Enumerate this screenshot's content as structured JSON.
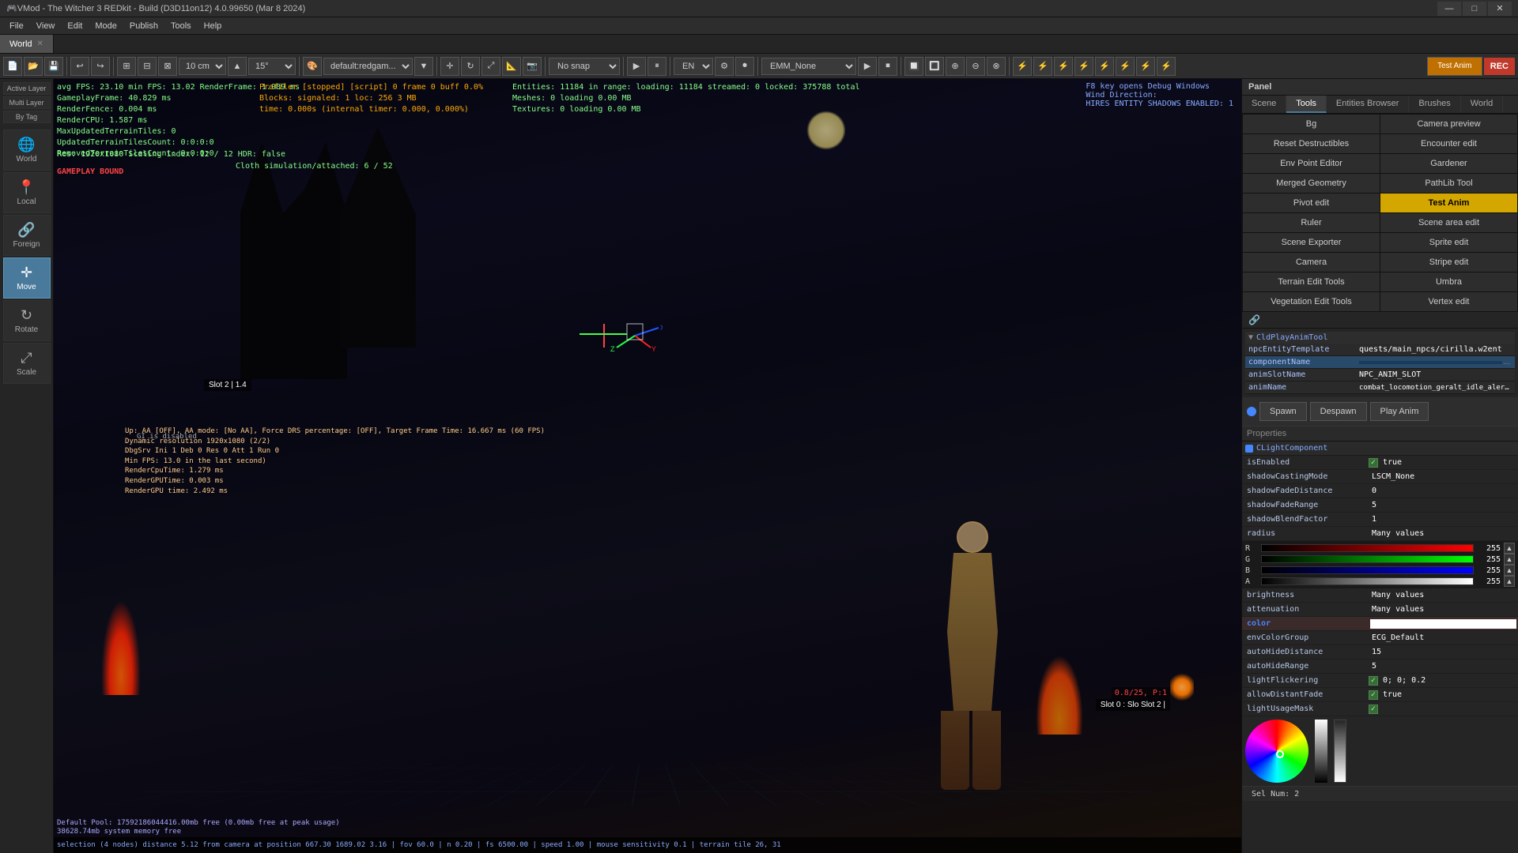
{
  "titlebar": {
    "title": "VMod - The Witcher 3 REDkit - Build (D3D11on12) 4.0.99650 (Mar 8 2024)",
    "minimize": "—",
    "maximize": "□",
    "close": "✕"
  },
  "menubar": {
    "items": [
      "File",
      "View",
      "Edit",
      "Mode",
      "Publish",
      "Tools",
      "Help"
    ]
  },
  "tab": {
    "label": "World",
    "close": "✕"
  },
  "toolbar": {
    "cm_value": "10 cm",
    "angle_value": "15°",
    "material": "default:redgam...",
    "snap": "No snap",
    "lang": "EN",
    "emm": "EMM_None",
    "anim_btn": "Test Anim",
    "rec": "REC"
  },
  "left_panel": {
    "layers": [
      "Active Layer",
      "Multi Layer",
      "By Tag"
    ],
    "tools": [
      {
        "id": "world",
        "label": "World",
        "icon": "🌐"
      },
      {
        "id": "local",
        "label": "Local",
        "icon": "📍"
      },
      {
        "id": "foreign",
        "label": "Foreign",
        "icon": "🔗"
      },
      {
        "id": "move",
        "label": "Move",
        "icon": "✛"
      },
      {
        "id": "rotate",
        "label": "Rotate",
        "icon": "↻"
      },
      {
        "id": "scale",
        "label": "Scale",
        "icon": "⤢"
      }
    ]
  },
  "viewport": {
    "stats_line1": "avg FPS: 23.10   min FPS: 13.02   RenderFrame: 1.089 ms",
    "stats_line2": "GameplayFrame: 40.829 ms",
    "stats_line3": "RenderFence: 0.004 ms",
    "stats_line4": "RenderCPU: 1.587 ms",
    "stats_line5": "MaxUpdatedTerrainTiles: 0",
    "stats_line6": "UpdatedTerrainTilesCount: 0:0:0:0",
    "stats_line7": "RemovedTerrainTilesCount: 0:0:0:0",
    "stats_col2_line1": "Profiler [stopped] [script] 0 frame 0 buff 0.0%",
    "stats_col2_line2": "Blocks: signaled: 1 loc: 256 3 MB",
    "stats_col2_line3": "time: 0.000s (internal timer: 0.000, 0.000%)",
    "entities_info": "Entities: 11184 in range: loading: 11184 streamed: 0 locked: 375788 total",
    "meshes_info": "Meshes: 0 loading 0.00 MB",
    "textures_info": "Textures: 0 loading 0.00 MB",
    "wind_info": "F8 key opens Debug Windows\nWind Direction:\nHIRES ENTITY SHADOWS ENABLED: 1",
    "res_info": "Res: 1920x1080  Scaling index: 12 / 12   HDR: false",
    "cloth_info": "Cloth simulation/attached: 6 / 52",
    "gameplay_bound": "GAMEPLAY BOUND",
    "gl_disabled": "GI is disabled",
    "debug_line1": "Up: AA [OFF], AA mode: [No AA], Force DRS percentage: [OFF], Target Frame Time: 16.667 ms (60 FPS)",
    "debug_line2": "Dynamic resolution 1920x1080 (2/2)",
    "debug_line3": "DbgSrv Ini 1 Deb 0 Res 0 Att 1 Run 0",
    "debug_line4": "Min FPS: 13.0 in the last second)",
    "debug_line5": "RenderCpuTime: 1.279 ms",
    "debug_line6": "RenderGPUTime: 0.003 ms",
    "debug_line7": "RenderGPU time: 2.492 ms",
    "slot1": "Slot 2  |  1.4",
    "slot2": "Slot 0 : Slo  Slot 2 |",
    "pos": "0.8/25, P:1",
    "pool_info": "Default Pool: 17592186044416.00mb free (0.00mb free at peak usage)",
    "memory_info": "38628.74mb system memory free",
    "status_bar": "selection (4 nodes) distance 5.12 from camera at position 667.30  1689.02  3.16 | fov 60.0 | n 0.20 | fs 6500.00 | speed 1.00 | mouse sensitivity 0.1 | terrain tile 26, 31"
  },
  "right_panel": {
    "header": "Panel",
    "tabs": [
      "Scene",
      "Tools",
      "Entities Browser",
      "Brushes",
      "World"
    ],
    "active_tab": "Tools",
    "subtabs": {
      "bg": "Bg",
      "camera_preview": "Camera preview",
      "reset_destructibles": "Reset Destructibles",
      "encounter_edit": "Encounter edit",
      "env_point_editor": "Env Point Editor",
      "gardener": "Gardener",
      "merged_geometry": "Merged Geometry",
      "pathlib_tool": "PathLib Tool",
      "pivot_edit": "Pivot edit",
      "test_anim": "Test Anim",
      "ruler": "Ruler",
      "scene_area_edit": "Scene area edit",
      "scene_exporter": "Scene Exporter",
      "sprite_edit": "Sprite edit",
      "camera": "Camera",
      "stripe_edit": "Stripe edit",
      "terrain_edit_tools": "Terrain Edit Tools",
      "umbra": "Umbra",
      "vegetation_edit_tools": "Vegetation Edit Tools",
      "vertex_edit": "Vertex edit"
    },
    "link_icon": "🔗",
    "spawn_buttons": [
      "Spawn",
      "Despawn",
      "Play Anim"
    ],
    "color_dot": "●",
    "anim_tool": {
      "header": "CldPlayAnimTool",
      "rows": [
        {
          "key": "npcEntityTemplate",
          "value": "quests/main_npcs/cirilla.w2ent"
        },
        {
          "key": "componentName",
          "value": ""
        },
        {
          "key": "animSlotName",
          "value": "NPC_ANIM_SLOT"
        },
        {
          "key": "animName",
          "value": "combat_locomotion_geralt_idle_alert_far"
        }
      ]
    },
    "properties": {
      "header": "Properties",
      "component_header": "CLightComponent",
      "rows": [
        {
          "key": "isEnabled",
          "value": "true",
          "checkbox": true
        },
        {
          "key": "shadowCastingMode",
          "value": "LSCM_None",
          "checkbox": false
        },
        {
          "key": "shadowFadeDistance",
          "value": "0",
          "checkbox": false
        },
        {
          "key": "shadowFadeRange",
          "value": "5",
          "checkbox": false
        },
        {
          "key": "shadowBlendFactor",
          "value": "1",
          "checkbox": false
        },
        {
          "key": "radius",
          "value": "Many values",
          "checkbox": false
        },
        {
          "key": "brightness",
          "value": "Many values",
          "checkbox": false
        },
        {
          "key": "attenuation",
          "value": "Many values",
          "checkbox": false
        },
        {
          "key": "color",
          "value": "",
          "checkbox": false,
          "highlight": true
        },
        {
          "key": "envColorGroup",
          "value": "ECG_Default",
          "checkbox": false
        },
        {
          "key": "autoHideDistance",
          "value": "15",
          "checkbox": false
        },
        {
          "key": "autoHideRange",
          "value": "5",
          "checkbox": false
        },
        {
          "key": "lightFlickering",
          "value": "0; 0; 0.2",
          "checkbox": true
        },
        {
          "key": "allowDistantFade",
          "value": "true",
          "checkbox": true
        },
        {
          "key": "lightUsageMask",
          "value": "",
          "checkbox": true
        }
      ]
    },
    "color_sliders": {
      "r_label": "R",
      "r_value": "255",
      "g_label": "G",
      "g_value": "255",
      "b_label": "B",
      "b_value": "255",
      "a_label": "A",
      "a_value": "255"
    },
    "sel_num": "Sel Num: 2"
  }
}
